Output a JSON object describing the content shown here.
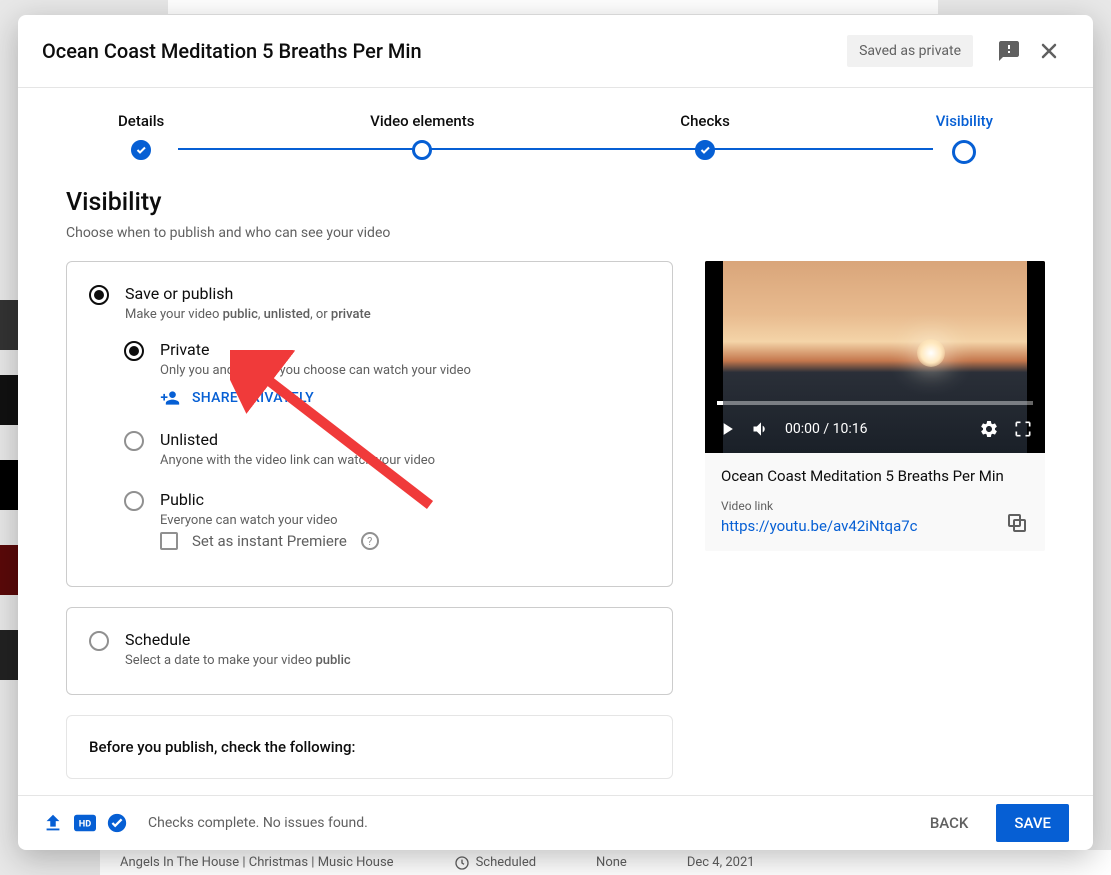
{
  "dialog": {
    "title": "Ocean Coast Meditation 5 Breaths Per Min",
    "savedBadge": "Saved as private"
  },
  "stepper": {
    "steps": [
      "Details",
      "Video elements",
      "Checks",
      "Visibility"
    ]
  },
  "visibility": {
    "heading": "Visibility",
    "sub": "Choose when to publish and who can see your video",
    "saveOrPublish": {
      "label": "Save or publish",
      "descPrefix": "Make your video ",
      "descB1": "public",
      "descMid": ", ",
      "descB2": "unlisted",
      "descMid2": ", or ",
      "descB3": "private"
    },
    "private": {
      "label": "Private",
      "desc": "Only you and people you choose can watch your video",
      "shareBtn": "SHARE PRIVATELY"
    },
    "unlisted": {
      "label": "Unlisted",
      "desc": "Anyone with the video link can watch your video"
    },
    "public": {
      "label": "Public",
      "desc": "Everyone can watch your video",
      "premiere": "Set as instant Premiere"
    },
    "schedule": {
      "label": "Schedule",
      "descPrefix": "Select a date to make your video ",
      "descB": "public"
    },
    "beforePublish": "Before you publish, check the following:"
  },
  "preview": {
    "time": "00:00 / 10:16",
    "title": "Ocean Coast Meditation 5 Breaths Per Min",
    "linkLabel": "Video link",
    "linkUrl": "https://youtu.be/av42iNtqa7c"
  },
  "footer": {
    "status": "Checks complete. No issues found.",
    "back": "BACK",
    "save": "SAVE"
  },
  "background": {
    "row": {
      "title": "Angels In The House | Christmas | Music House",
      "status": "Scheduled",
      "restrict": "None",
      "date": "Dec 4, 2021"
    }
  }
}
